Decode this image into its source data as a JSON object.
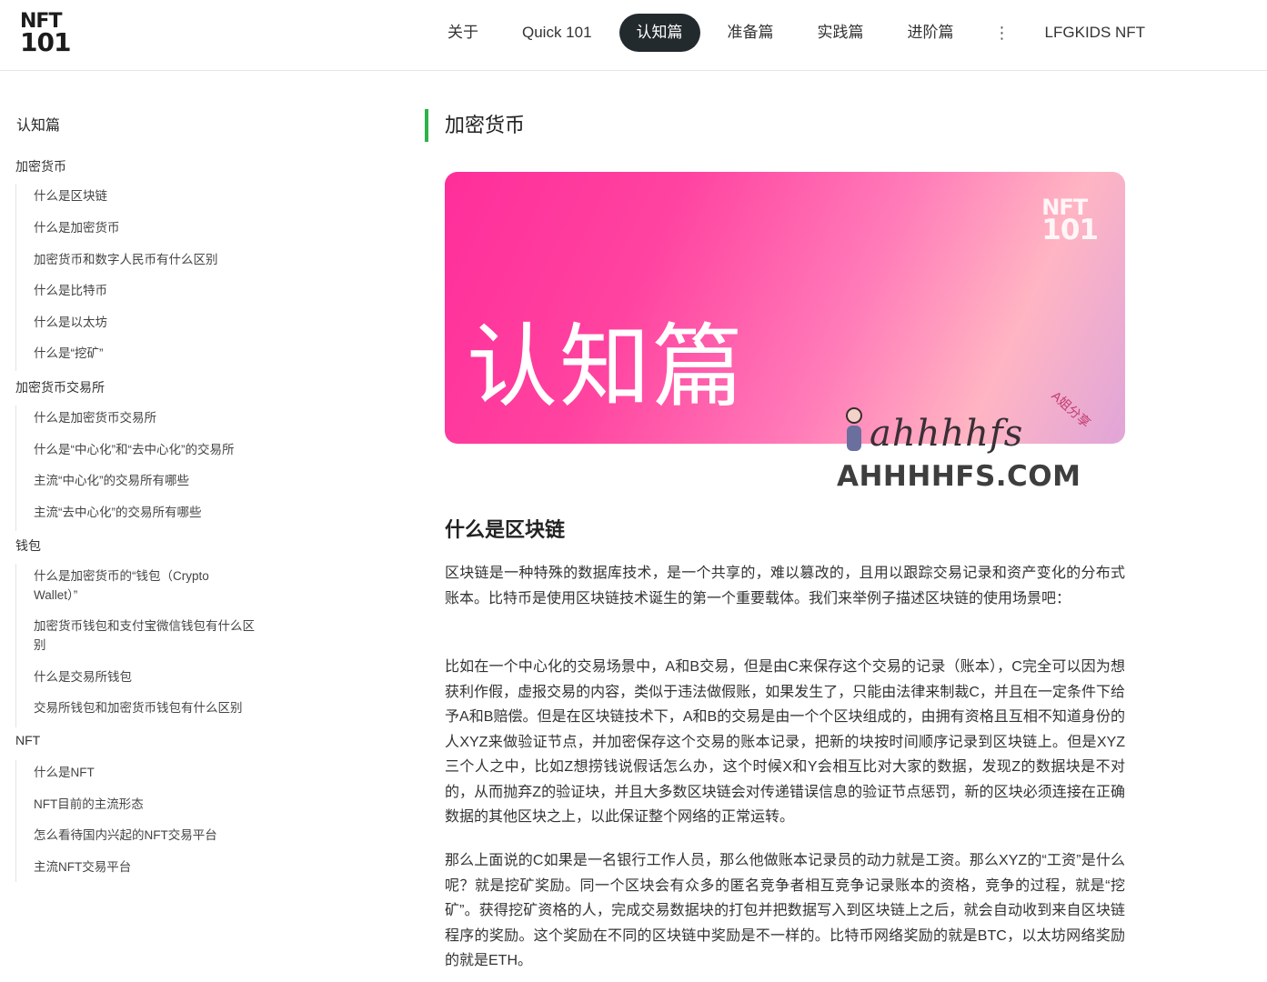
{
  "logo": {
    "line1": "NFT",
    "line2": "101"
  },
  "nav": {
    "items": [
      {
        "label": "关于"
      },
      {
        "label": "Quick 101"
      },
      {
        "label": "认知篇",
        "active": true
      },
      {
        "label": "准备篇"
      },
      {
        "label": "实践篇"
      },
      {
        "label": "进阶篇"
      }
    ],
    "more_icon": "vertical-dots-icon",
    "more_symbol": "⋮",
    "extra": "LFGKIDS NFT"
  },
  "sidebar": {
    "title": "认知篇",
    "groups": [
      {
        "label": "加密货币",
        "items": [
          "什么是区块链",
          "什么是加密货币",
          "加密货币和数字人民币有什么区别",
          "什么是比特币",
          "什么是以太坊",
          "什么是“挖矿”"
        ]
      },
      {
        "label": "加密货币交易所",
        "items": [
          "什么是加密货币交易所",
          "什么是“中心化”和“去中心化”的交易所",
          "主流“中心化”的交易所有哪些",
          "主流“去中心化”的交易所有哪些"
        ]
      },
      {
        "label": "钱包",
        "items": [
          "什么是加密货币的“钱包（Crypto Wallet）”",
          "加密货币钱包和支付宝微信钱包有什么区别",
          "什么是交易所钱包",
          "交易所钱包和加密货币钱包有什么区别"
        ]
      },
      {
        "label": "NFT",
        "items": [
          "什么是NFT",
          "NFT目前的主流形态",
          "怎么看待国内兴起的NFT交易平台",
          "主流NFT交易平台"
        ]
      }
    ]
  },
  "main": {
    "section_title": "加密货币",
    "accent_color": "#2cb24b",
    "hero": {
      "logo_line1": "NFT",
      "logo_line2": "101",
      "title": "认知篇"
    },
    "watermark": {
      "script": "ahhhhfs",
      "side": "A姐分享",
      "domain": "AHHHHFS.COM"
    },
    "heading": "什么是区块链",
    "paragraphs": [
      "区块链是一种特殊的数据库技术，是一个共享的，难以篡改的，且用以跟踪交易记录和资产变化的分布式账本。比特币是使用区块链技术诞生的第一个重要载体。我们来举例子描述区块链的使用场景吧：",
      "比如在一个中心化的交易场景中，A和B交易，但是由C来保存这个交易的记录（账本），C完全可以因为想获利作假，虚报交易的内容，类似于违法做假账，如果发生了，只能由法律来制裁C，并且在一定条件下给予A和B赔偿。但是在区块链技术下，A和B的交易是由一个个区块组成的，由拥有资格且互相不知道身份的人XYZ来做验证节点，并加密保存这个交易的账本记录，把新的块按时间顺序记录到区块链上。但是XYZ三个人之中，比如Z想捞钱说假话怎么办，这个时候X和Y会相互比对大家的数据，发现Z的数据块是不对的，从而抛弃Z的验证块，并且大多数区块链会对传递错误信息的验证节点惩罚，新的区块必须连接在正确数据的其他区块之上，以此保证整个网络的正常运转。",
      "那么上面说的C如果是一名银行工作人员，那么他做账本记录员的动力就是工资。那么XYZ的“工资”是什么呢？就是挖矿奖励。同一个区块会有众多的匿名竞争者相互竞争记录账本的资格，竞争的过程，就是“挖矿”。获得挖矿资格的人，完成交易数据块的打包并把数据写入到区块链上之后，就会自动收到来自区块链程序的奖励。这个奖励在不同的区块链中奖励是不一样的。比特币网络奖励的就是BTC，以太坊网络奖励的就是ETH。"
    ]
  }
}
